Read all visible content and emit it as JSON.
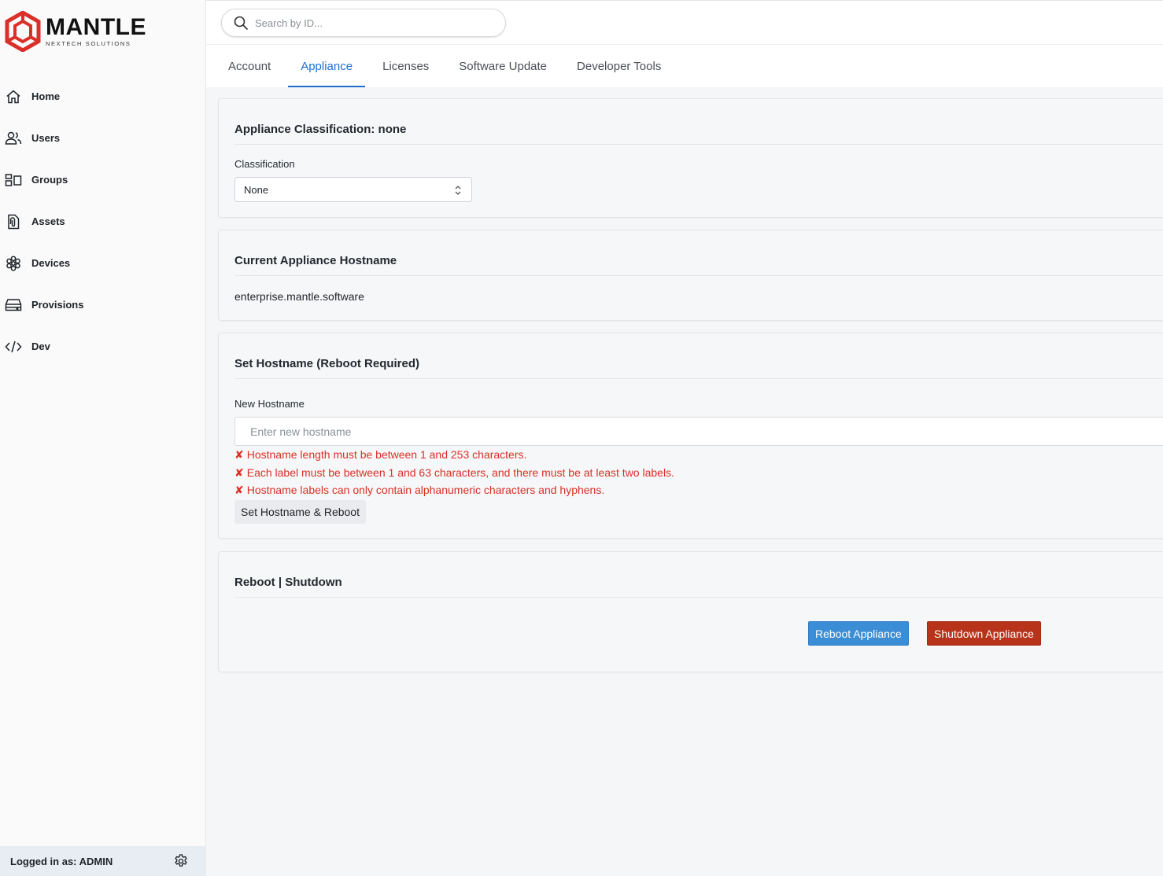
{
  "brand": {
    "name": "MANTLE",
    "tagline": "NEXTECH SOLUTIONS"
  },
  "colors": {
    "accent": "#1f6fd1",
    "error": "#d93025",
    "reboot": "#3b8ed6",
    "shutdown": "#b7331a",
    "logo": "#d9302a"
  },
  "sidebar": {
    "items": [
      {
        "label": "Home",
        "icon": "home-icon"
      },
      {
        "label": "Users",
        "icon": "users-icon"
      },
      {
        "label": "Groups",
        "icon": "groups-icon"
      },
      {
        "label": "Assets",
        "icon": "assets-icon"
      },
      {
        "label": "Devices",
        "icon": "devices-icon"
      },
      {
        "label": "Provisions",
        "icon": "provisions-icon"
      },
      {
        "label": "Dev",
        "icon": "code-icon"
      }
    ],
    "footer": {
      "logged_in": "Logged in as: ADMIN",
      "icon": "gear-icon"
    }
  },
  "search": {
    "placeholder": "Search by ID..."
  },
  "tabs": [
    {
      "label": "Account"
    },
    {
      "label": "Appliance",
      "active": true
    },
    {
      "label": "Licenses"
    },
    {
      "label": "Software Update"
    },
    {
      "label": "Developer Tools"
    }
  ],
  "classification_card": {
    "title": "Appliance Classification: none",
    "label": "Classification",
    "selected": "None"
  },
  "hostname_card": {
    "title": "Current Appliance Hostname",
    "value": "enterprise.mantle.software"
  },
  "set_hostname_card": {
    "title": "Set Hostname (Reboot Required)",
    "label": "New Hostname",
    "placeholder": "Enter new hostname",
    "value": "",
    "error_mark": "✘",
    "errors": [
      "Hostname length must be between 1 and 253 characters.",
      "Each label must be between 1 and 63 characters, and there must be at least two labels.",
      "Hostname labels can only contain alphanumeric characters and hyphens."
    ],
    "button": "Set Hostname & Reboot"
  },
  "power_card": {
    "title": "Reboot | Shutdown",
    "reboot_button": "Reboot Appliance",
    "shutdown_button": "Shutdown Appliance"
  }
}
